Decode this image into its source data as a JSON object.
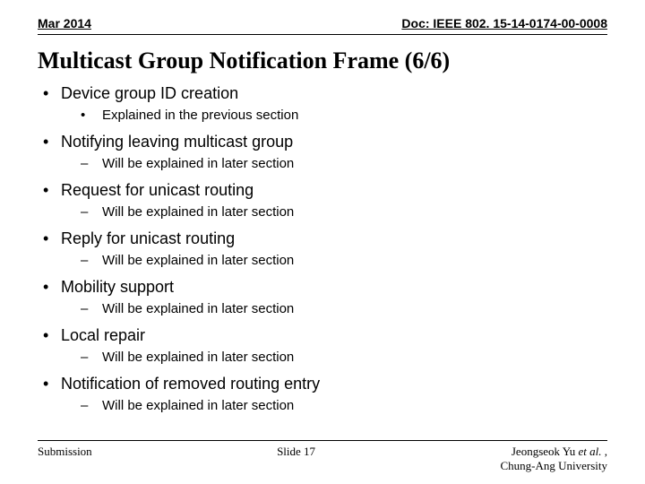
{
  "header": {
    "date": "Mar 2014",
    "doc": "Doc: IEEE 802. 15-14-0174-00-0008"
  },
  "title": "Multicast Group Notification Frame (6/6)",
  "bullets": [
    {
      "text": "Device group ID creation",
      "sub_mark": "•",
      "sub": "Explained in the previous section"
    },
    {
      "text": "Notifying leaving multicast group",
      "sub_mark": "–",
      "sub": "Will be explained in later section"
    },
    {
      "text": "Request for unicast routing",
      "sub_mark": "–",
      "sub": "Will be explained in later section"
    },
    {
      "text": "Reply for unicast routing",
      "sub_mark": "–",
      "sub": "Will be explained in later section"
    },
    {
      "text": "Mobility support",
      "sub_mark": "–",
      "sub": "Will be explained in later section"
    },
    {
      "text": "Local repair",
      "sub_mark": "–",
      "sub": "Will be explained in later section"
    },
    {
      "text": "Notification of removed routing entry",
      "sub_mark": "–",
      "sub": "Will be explained in later section"
    }
  ],
  "footer": {
    "left": "Submission",
    "center": "Slide 17",
    "right_line1_a": "Jeongseok Yu ",
    "right_line1_b": "et al.",
    "right_line1_c": " ,",
    "right_line2": "Chung-Ang University"
  }
}
